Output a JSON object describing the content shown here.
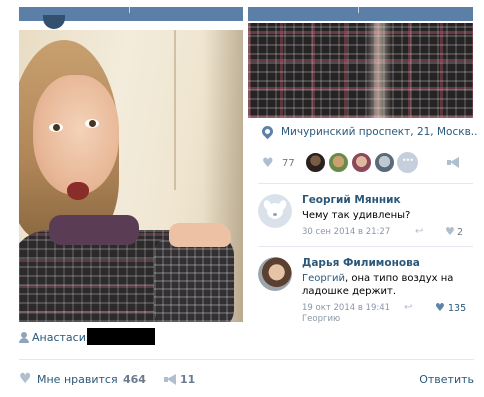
{
  "post": {
    "author_name": "Анастасия",
    "photo_left_desc": "",
    "location": "Мичуринский проспект, 21, Москв..",
    "photo_likes_count": "77"
  },
  "comments": [
    {
      "author": "Георгий Мянник",
      "text": "Чему так удивлены?",
      "mention": "",
      "date": "30 сен 2014 в 21:27",
      "likes": "2",
      "liked": false
    },
    {
      "author": "Дарья Филимонова",
      "mention": "Георгий",
      "text": ", она типо воздух на ладошке держит.",
      "date": "19 окт 2014 в 19:41",
      "reply_to": "Георгию",
      "likes": "135",
      "liked": true
    }
  ],
  "footer": {
    "like_label": "Мне нравится",
    "like_count": "464",
    "share_count": "11",
    "reply_label": "Ответить"
  },
  "colors": {
    "link": "#2b587a",
    "header_bar": "#5b7fa6",
    "icon_gray": "#b0bfcd",
    "liked_heart": "#5e82a8"
  }
}
